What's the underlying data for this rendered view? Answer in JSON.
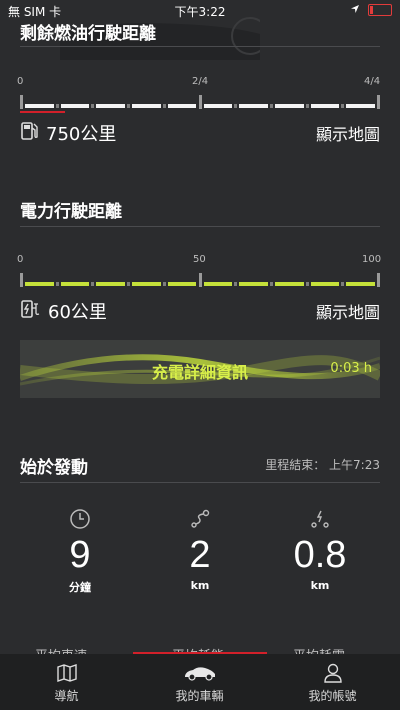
{
  "status_bar": {
    "carrier": "無 SIM 卡",
    "time": "下午3:22"
  },
  "fuel": {
    "title": "剩餘燃油行駛距離",
    "scale": [
      "0",
      "2/4",
      "4/4"
    ],
    "level_fraction": 0.125,
    "value": "750公里",
    "map_link": "顯示地圖"
  },
  "electric": {
    "title": "電力行駛距離",
    "scale": [
      "0",
      "50",
      "100"
    ],
    "level_percent": 100,
    "value": "60公里",
    "map_link": "顯示地圖"
  },
  "charge_banner": {
    "title": "充電詳細資訊",
    "time": "0:03 h"
  },
  "trip": {
    "title": "始於發動",
    "end_time": "里程結束： 上午7:23",
    "stats": [
      {
        "icon": "clock-icon",
        "value": "9",
        "unit": "分鐘"
      },
      {
        "icon": "route-icon",
        "value": "2",
        "unit": "km"
      },
      {
        "icon": "electric-route-icon",
        "value": "0.8",
        "unit": "km"
      }
    ]
  },
  "tabs": [
    "平均車速",
    "平均耗能",
    "平均耗電"
  ],
  "bottom_nav": [
    {
      "icon": "map-icon",
      "label": "導航"
    },
    {
      "icon": "car-icon",
      "label": "我的車輛"
    },
    {
      "icon": "account-icon",
      "label": "我的帳號"
    }
  ],
  "colors": {
    "accent_green": "#c5e13a",
    "accent_red": "#d2202a",
    "background": "#2b2c2e"
  }
}
